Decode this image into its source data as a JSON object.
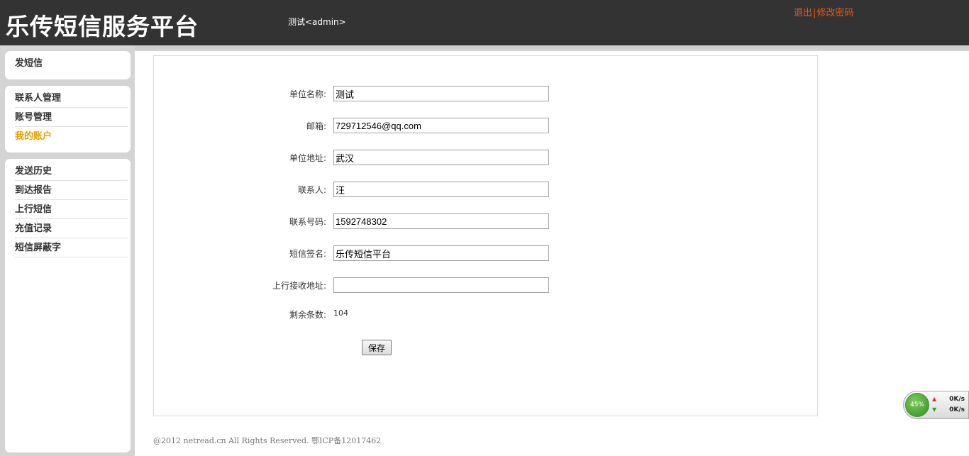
{
  "header": {
    "title": "乐传短信服务平台",
    "user_info": "测试<admin>",
    "logout_label": "退出",
    "separator": "|",
    "change_password_label": "修改密码",
    "link_color": "#e25c1c"
  },
  "sidebar": {
    "groups": [
      {
        "items": [
          {
            "label": "发短信"
          }
        ]
      },
      {
        "items": [
          {
            "label": "联系人管理"
          },
          {
            "label": "账号管理"
          },
          {
            "label": "我的账户",
            "active": true
          }
        ]
      },
      {
        "items": [
          {
            "label": "发送历史"
          },
          {
            "label": "到达报告"
          },
          {
            "label": "上行短信"
          },
          {
            "label": "充值记录"
          },
          {
            "label": "短信屏蔽字"
          }
        ]
      }
    ],
    "active_color": "#e8a000"
  },
  "form": {
    "fields": [
      {
        "label": "单位名称:",
        "value": "测试"
      },
      {
        "label": "邮箱:",
        "value": "729712546@qq.com"
      },
      {
        "label": "单位地址:",
        "value": "武汉"
      },
      {
        "label": "联系人:",
        "value": "汪"
      },
      {
        "label": "联系号码:",
        "value": "1592748302"
      },
      {
        "label": "短信签名:",
        "value": "乐传短信平台"
      },
      {
        "label": "上行接收地址:",
        "value": ""
      }
    ],
    "remaining_label": "剩余条数:",
    "remaining_value": "104",
    "save_label": "保存"
  },
  "footer": {
    "text": "@2012 netread.cn All Rights Reserved. 鄂ICP备12017462"
  },
  "speed_widget": {
    "percent": "45%",
    "up_speed": "0K/s",
    "down_speed": "0K/s",
    "up_icon": "arrow-up-icon",
    "down_icon": "arrow-down-icon"
  }
}
